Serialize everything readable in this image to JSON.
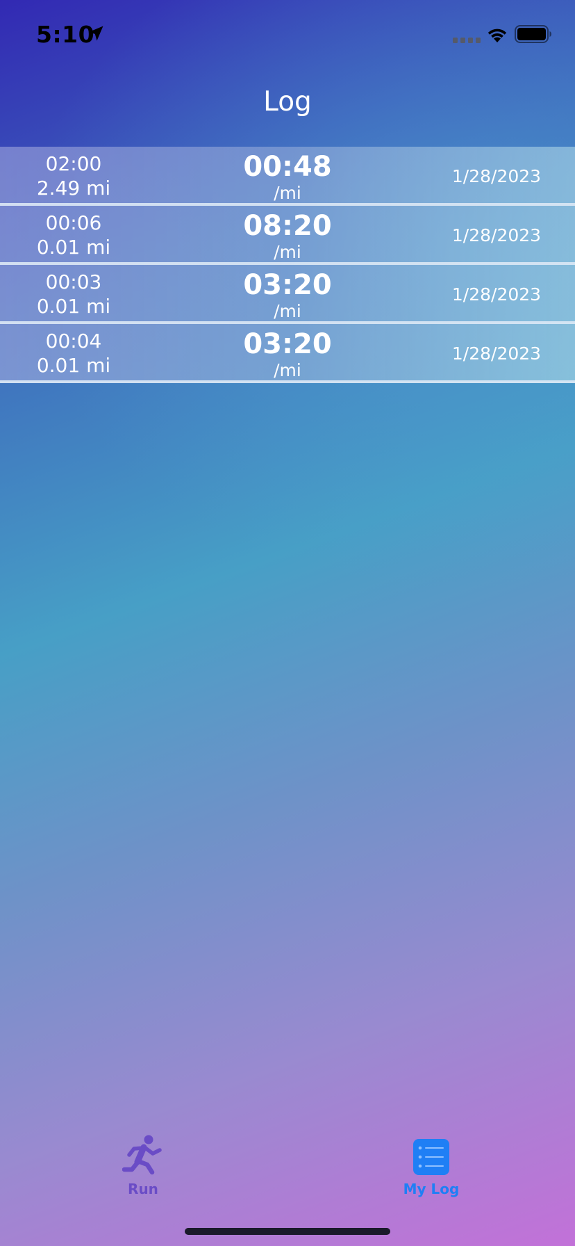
{
  "status_bar": {
    "time": "5:10",
    "icons": [
      "location-arrow-icon",
      "cell-signal-icon",
      "wifi-icon",
      "battery-icon"
    ]
  },
  "nav": {
    "title": "Log"
  },
  "log_entries": [
    {
      "duration": "02:00",
      "distance": "2.49 mi",
      "pace": "00:48",
      "pace_unit": "/mi",
      "date": "1/28/2023"
    },
    {
      "duration": "00:06",
      "distance": "0.01 mi",
      "pace": "08:20",
      "pace_unit": "/mi",
      "date": "1/28/2023"
    },
    {
      "duration": "00:03",
      "distance": "0.01 mi",
      "pace": "03:20",
      "pace_unit": "/mi",
      "date": "1/28/2023"
    },
    {
      "duration": "00:04",
      "distance": "0.01 mi",
      "pace": "03:20",
      "pace_unit": "/mi",
      "date": "1/28/2023"
    }
  ],
  "tab_bar": {
    "tabs": [
      {
        "label": "Run",
        "icon": "running-person-icon",
        "selected": false
      },
      {
        "label": "My Log",
        "icon": "list-icon",
        "selected": true
      }
    ]
  },
  "colors": {
    "tab_selected": "#1f7ff5",
    "tab_unselected": "#6a4cc6",
    "gradient_top": "#3229b3",
    "gradient_bottom": "#c271d8"
  }
}
